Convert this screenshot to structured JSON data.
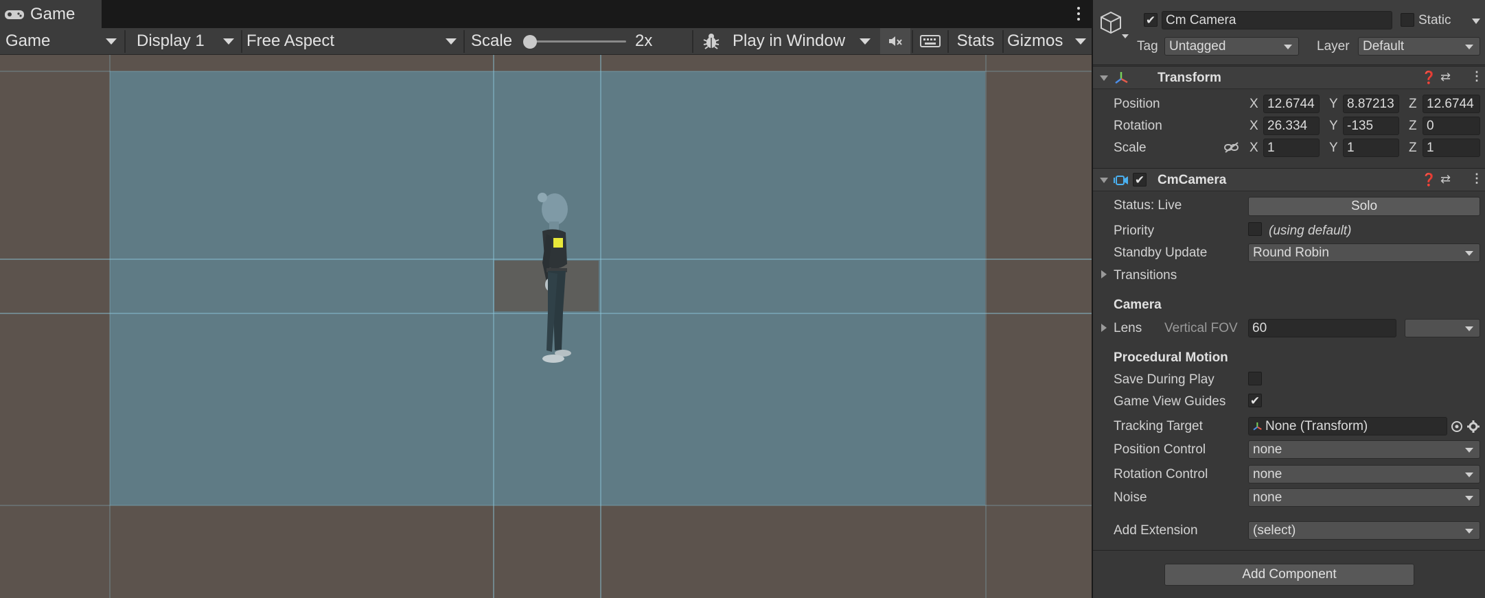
{
  "game": {
    "tab_label": "Game",
    "toolbar": {
      "view_mode": "Game",
      "display": "Display 1",
      "aspect": "Free Aspect",
      "scale_label": "Scale",
      "scale_value": "2x",
      "play_mode": "Play in Window",
      "stats_label": "Stats",
      "gizmos_label": "Gizmos"
    }
  },
  "inspector": {
    "header": {
      "object_name": "Cm Camera",
      "static_label": "Static",
      "tag_label": "Tag",
      "tag_value": "Untagged",
      "layer_label": "Layer",
      "layer_value": "Default"
    },
    "transform": {
      "title": "Transform",
      "position_label": "Position",
      "rotation_label": "Rotation",
      "scale_label": "Scale",
      "axis_x": "X",
      "axis_y": "Y",
      "axis_z": "Z",
      "position": {
        "x": "12.6744",
        "y": "8.87213",
        "z": "12.6744"
      },
      "rotation": {
        "x": "26.334",
        "y": "-135",
        "z": "0"
      },
      "scale": {
        "x": "1",
        "y": "1",
        "z": "1"
      }
    },
    "cm_camera": {
      "title": "CmCamera",
      "status_label": "Status: Live",
      "solo_label": "Solo",
      "priority_label": "Priority",
      "priority_note": "(using default)",
      "standby_label": "Standby Update",
      "standby_value": "Round Robin",
      "transitions_label": "Transitions",
      "camera_section": "Camera",
      "lens_label": "Lens",
      "fov_label": "Vertical FOV",
      "fov_value": "60",
      "procedural_section": "Procedural Motion",
      "save_during_play_label": "Save During Play",
      "game_view_guides_label": "Game View Guides",
      "tracking_target_label": "Tracking Target",
      "tracking_target_value": "None (Transform)",
      "position_control_label": "Position Control",
      "position_control_value": "none",
      "rotation_control_label": "Rotation Control",
      "rotation_control_value": "none",
      "noise_label": "Noise",
      "noise_value": "none",
      "add_extension_label": "Add Extension",
      "add_extension_value": "(select)"
    },
    "add_component_label": "Add Component"
  },
  "colors": {
    "viewport_bg": "#5c534d",
    "frame_blue": "#5f7b85",
    "guide_cyan": "#8cc8dc",
    "marker_yellow": "#e8e83a"
  }
}
